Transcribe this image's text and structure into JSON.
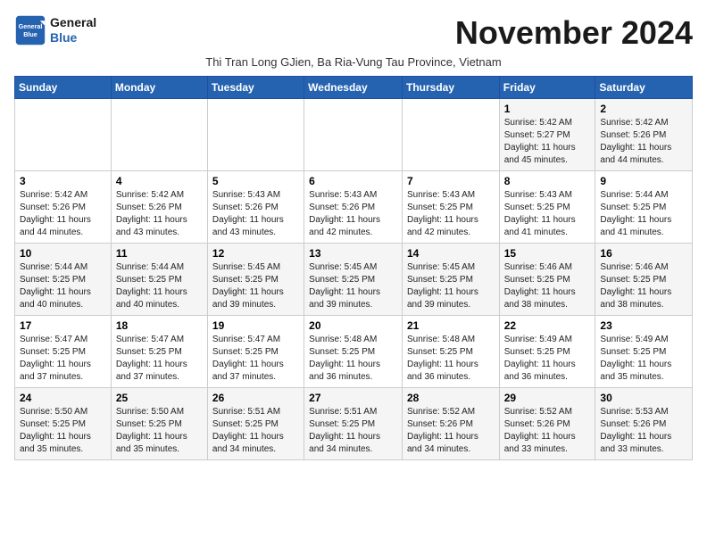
{
  "logo": {
    "line1": "General",
    "line2": "Blue"
  },
  "title": "November 2024",
  "subtitle": "Thi Tran Long GJien, Ba Ria-Vung Tau Province, Vietnam",
  "weekdays": [
    "Sunday",
    "Monday",
    "Tuesday",
    "Wednesday",
    "Thursday",
    "Friday",
    "Saturday"
  ],
  "weeks": [
    [
      {
        "day": "",
        "info": ""
      },
      {
        "day": "",
        "info": ""
      },
      {
        "day": "",
        "info": ""
      },
      {
        "day": "",
        "info": ""
      },
      {
        "day": "",
        "info": ""
      },
      {
        "day": "1",
        "info": "Sunrise: 5:42 AM\nSunset: 5:27 PM\nDaylight: 11 hours and 45 minutes."
      },
      {
        "day": "2",
        "info": "Sunrise: 5:42 AM\nSunset: 5:26 PM\nDaylight: 11 hours and 44 minutes."
      }
    ],
    [
      {
        "day": "3",
        "info": "Sunrise: 5:42 AM\nSunset: 5:26 PM\nDaylight: 11 hours and 44 minutes."
      },
      {
        "day": "4",
        "info": "Sunrise: 5:42 AM\nSunset: 5:26 PM\nDaylight: 11 hours and 43 minutes."
      },
      {
        "day": "5",
        "info": "Sunrise: 5:43 AM\nSunset: 5:26 PM\nDaylight: 11 hours and 43 minutes."
      },
      {
        "day": "6",
        "info": "Sunrise: 5:43 AM\nSunset: 5:26 PM\nDaylight: 11 hours and 42 minutes."
      },
      {
        "day": "7",
        "info": "Sunrise: 5:43 AM\nSunset: 5:25 PM\nDaylight: 11 hours and 42 minutes."
      },
      {
        "day": "8",
        "info": "Sunrise: 5:43 AM\nSunset: 5:25 PM\nDaylight: 11 hours and 41 minutes."
      },
      {
        "day": "9",
        "info": "Sunrise: 5:44 AM\nSunset: 5:25 PM\nDaylight: 11 hours and 41 minutes."
      }
    ],
    [
      {
        "day": "10",
        "info": "Sunrise: 5:44 AM\nSunset: 5:25 PM\nDaylight: 11 hours and 40 minutes."
      },
      {
        "day": "11",
        "info": "Sunrise: 5:44 AM\nSunset: 5:25 PM\nDaylight: 11 hours and 40 minutes."
      },
      {
        "day": "12",
        "info": "Sunrise: 5:45 AM\nSunset: 5:25 PM\nDaylight: 11 hours and 39 minutes."
      },
      {
        "day": "13",
        "info": "Sunrise: 5:45 AM\nSunset: 5:25 PM\nDaylight: 11 hours and 39 minutes."
      },
      {
        "day": "14",
        "info": "Sunrise: 5:45 AM\nSunset: 5:25 PM\nDaylight: 11 hours and 39 minutes."
      },
      {
        "day": "15",
        "info": "Sunrise: 5:46 AM\nSunset: 5:25 PM\nDaylight: 11 hours and 38 minutes."
      },
      {
        "day": "16",
        "info": "Sunrise: 5:46 AM\nSunset: 5:25 PM\nDaylight: 11 hours and 38 minutes."
      }
    ],
    [
      {
        "day": "17",
        "info": "Sunrise: 5:47 AM\nSunset: 5:25 PM\nDaylight: 11 hours and 37 minutes."
      },
      {
        "day": "18",
        "info": "Sunrise: 5:47 AM\nSunset: 5:25 PM\nDaylight: 11 hours and 37 minutes."
      },
      {
        "day": "19",
        "info": "Sunrise: 5:47 AM\nSunset: 5:25 PM\nDaylight: 11 hours and 37 minutes."
      },
      {
        "day": "20",
        "info": "Sunrise: 5:48 AM\nSunset: 5:25 PM\nDaylight: 11 hours and 36 minutes."
      },
      {
        "day": "21",
        "info": "Sunrise: 5:48 AM\nSunset: 5:25 PM\nDaylight: 11 hours and 36 minutes."
      },
      {
        "day": "22",
        "info": "Sunrise: 5:49 AM\nSunset: 5:25 PM\nDaylight: 11 hours and 36 minutes."
      },
      {
        "day": "23",
        "info": "Sunrise: 5:49 AM\nSunset: 5:25 PM\nDaylight: 11 hours and 35 minutes."
      }
    ],
    [
      {
        "day": "24",
        "info": "Sunrise: 5:50 AM\nSunset: 5:25 PM\nDaylight: 11 hours and 35 minutes."
      },
      {
        "day": "25",
        "info": "Sunrise: 5:50 AM\nSunset: 5:25 PM\nDaylight: 11 hours and 35 minutes."
      },
      {
        "day": "26",
        "info": "Sunrise: 5:51 AM\nSunset: 5:25 PM\nDaylight: 11 hours and 34 minutes."
      },
      {
        "day": "27",
        "info": "Sunrise: 5:51 AM\nSunset: 5:25 PM\nDaylight: 11 hours and 34 minutes."
      },
      {
        "day": "28",
        "info": "Sunrise: 5:52 AM\nSunset: 5:26 PM\nDaylight: 11 hours and 34 minutes."
      },
      {
        "day": "29",
        "info": "Sunrise: 5:52 AM\nSunset: 5:26 PM\nDaylight: 11 hours and 33 minutes."
      },
      {
        "day": "30",
        "info": "Sunrise: 5:53 AM\nSunset: 5:26 PM\nDaylight: 11 hours and 33 minutes."
      }
    ]
  ]
}
